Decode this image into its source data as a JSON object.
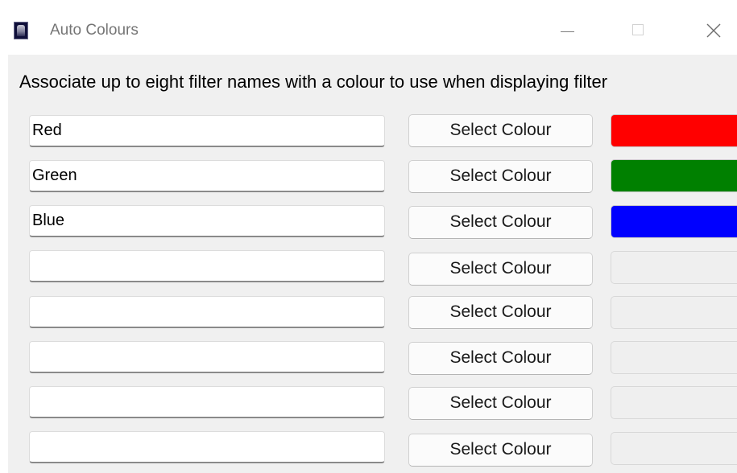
{
  "window": {
    "title": "Auto Colours",
    "app_icon": "telescope-app-icon"
  },
  "description": "Associate up to eight filter names with a colour to use when displaying filter",
  "rows": [
    {
      "name": "Red",
      "button_label": "Select Colour",
      "colour": "#ff0000"
    },
    {
      "name": "Green",
      "button_label": "Select Colour",
      "colour": "#008000"
    },
    {
      "name": "Blue",
      "button_label": "Select Colour",
      "colour": "#0000ff"
    },
    {
      "name": "",
      "button_label": "Select Colour",
      "colour": ""
    },
    {
      "name": "",
      "button_label": "Select Colour",
      "colour": ""
    },
    {
      "name": "",
      "button_label": "Select Colour",
      "colour": ""
    },
    {
      "name": "",
      "button_label": "Select Colour",
      "colour": ""
    },
    {
      "name": "",
      "button_label": "Select Colour",
      "colour": ""
    }
  ]
}
